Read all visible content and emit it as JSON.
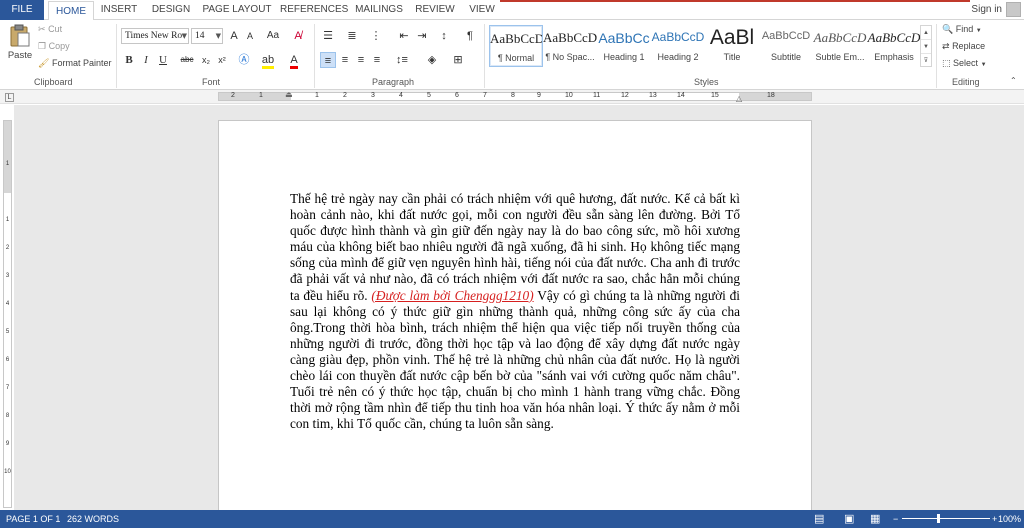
{
  "tabs": {
    "file": "FILE",
    "items": [
      "HOME",
      "INSERT",
      "DESIGN",
      "PAGE LAYOUT",
      "REFERENCES",
      "MAILINGS",
      "REVIEW",
      "VIEW"
    ],
    "active": "HOME",
    "sign_in": "Sign in"
  },
  "clipboard": {
    "paste": "Paste",
    "cut": "Cut",
    "copy": "Copy",
    "format_painter": "Format Painter",
    "label": "Clipboard"
  },
  "font": {
    "family": "Times New Ro",
    "size": "14",
    "label": "Font",
    "change_case": "Aa",
    "bold": "B",
    "italic": "I",
    "underline": "U",
    "strike": "abc",
    "subscript": "x₂",
    "superscript": "x²",
    "grow": "A",
    "shrink": "A"
  },
  "paragraph": {
    "label": "Paragraph",
    "pilcrow": "¶"
  },
  "styles": {
    "label": "Styles",
    "items": [
      {
        "sample": "AaBbCcDc",
        "name": "¶ Normal"
      },
      {
        "sample": "AaBbCcDc",
        "name": "¶ No Spac..."
      },
      {
        "sample": "AaBbCc",
        "name": "Heading 1"
      },
      {
        "sample": "AaBbCcD",
        "name": "Heading 2"
      },
      {
        "sample": "AaBl",
        "name": "Title"
      },
      {
        "sample": "AaBbCcD",
        "name": "Subtitle"
      },
      {
        "sample": "AaBbCcD",
        "name": "Subtle Em..."
      },
      {
        "sample": "AaBbCcD",
        "name": "Emphasis"
      }
    ]
  },
  "editing": {
    "label": "Editing",
    "find": "Find",
    "replace": "Replace",
    "select": "Select"
  },
  "ruler": {
    "numbers": [
      "2",
      "1",
      "1",
      "2",
      "3",
      "4",
      "5",
      "6",
      "7",
      "8",
      "9",
      "10",
      "11",
      "12",
      "13",
      "14",
      "15",
      "16",
      "18"
    ],
    "vnumbers": [
      "1",
      "1",
      "2",
      "3",
      "4",
      "5",
      "6",
      "7",
      "8",
      "9",
      "10",
      "11",
      "12"
    ]
  },
  "document": {
    "text_before": "Thế hệ trẻ ngày nay cần phải có trách nhiệm với quê hương, đất nước.  Kể cả bất kì hoàn cảnh nào, khi đất nước gọi, mỗi con người đều sẵn sàng lên đường. Bởi Tổ quốc được hình thành và gìn giữ đến ngày nay là do bao công sức, mồ hôi xương máu của không biết bao nhiêu người đã ngã xuống, đã hi sinh. Họ không tiếc mạng sống của mình để giữ vẹn nguyên hình hài, tiếng nói của đất nước. Cha anh đi trước đã phải vất vả như nào, đã có trách nhiệm với đất nước ra sao, chắc hẳn mỗi chúng ta đều hiểu rõ. ",
    "highlight": "(Được làm bởi Chenggg1210)",
    "text_after": " Vậy có gì chúng ta là những người đi sau lại không có ý thức giữ gìn những thành quả, những công sức ấy của cha ông.Trong thời hòa bình, trách nhiệm thể hiện qua việc tiếp nối truyền thống của những người đi trước, đồng thời học tập và lao động để xây dựng đất nước ngày càng giàu đẹp, phồn vinh.  Thế hệ trẻ là những chủ nhân của đất nước. Họ là người chèo lái con thuyền đất nước cập bến bờ của \"sánh vai với cường quốc năm châu\". Tuổi trẻ nên có ý thức học tập, chuẩn bị cho mình 1 hành trang vững chắc. Đồng thời mở rộng tầm nhìn để tiếp thu tinh hoa văn hóa nhân loại. Ý thức ấy nằm ở mỗi con tim, khi Tổ quốc cần, chúng ta luôn sẵn sàng."
  },
  "status": {
    "page": "PAGE 1 OF 1",
    "words": "262 WORDS",
    "zoom": "100%"
  },
  "colors": {
    "accent": "#2b579a",
    "highlight_text": "#d61f1f"
  }
}
